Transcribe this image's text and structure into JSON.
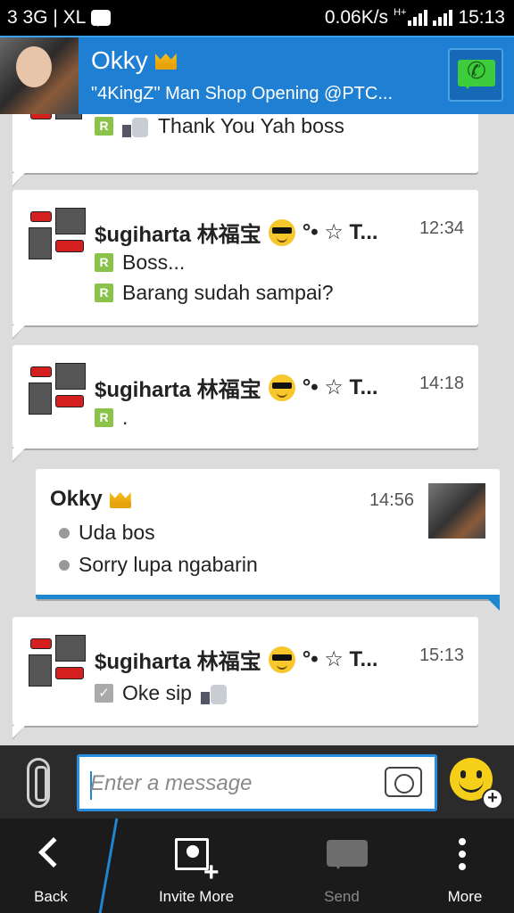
{
  "status_bar": {
    "carrier": "3 3G | XL",
    "speed": "0.06K/s",
    "network_type": "H+",
    "time": "15:13"
  },
  "header": {
    "contact_name": "Okky",
    "status_message": "\"4KingZ\" Man Shop Opening @PTC..."
  },
  "messages": [
    {
      "sender": "",
      "time": "",
      "lines": [
        "Thank You Yah boss"
      ],
      "line_marker": "R"
    },
    {
      "sender": "$ugiharta 林福宝",
      "suffix": "°• ☆ T...",
      "time": "12:34",
      "lines": [
        "Boss...",
        "Barang sudah sampai?"
      ],
      "line_marker": "R"
    },
    {
      "sender": "$ugiharta 林福宝",
      "suffix": "°• ☆ T...",
      "time": "14:18",
      "lines": [
        "."
      ],
      "line_marker": "R"
    },
    {
      "sender": "Okky",
      "time": "14:56",
      "lines": [
        "Uda bos",
        "Sorry lupa ngabarin"
      ],
      "line_marker": "bullet",
      "outgoing_from_contact": true
    },
    {
      "sender": "$ugiharta 林福宝",
      "suffix": "°• ☆ T...",
      "time": "15:13",
      "lines": [
        "Oke sip"
      ],
      "line_marker": "check"
    }
  ],
  "composer": {
    "placeholder": "Enter a message"
  },
  "bottom_bar": {
    "back": "Back",
    "invite_more": "Invite More",
    "send": "Send",
    "more": "More"
  },
  "colors": {
    "header_blue": "#1f7fd3",
    "accent_blue": "#1f86d0",
    "badge_green": "#8bc34a"
  }
}
